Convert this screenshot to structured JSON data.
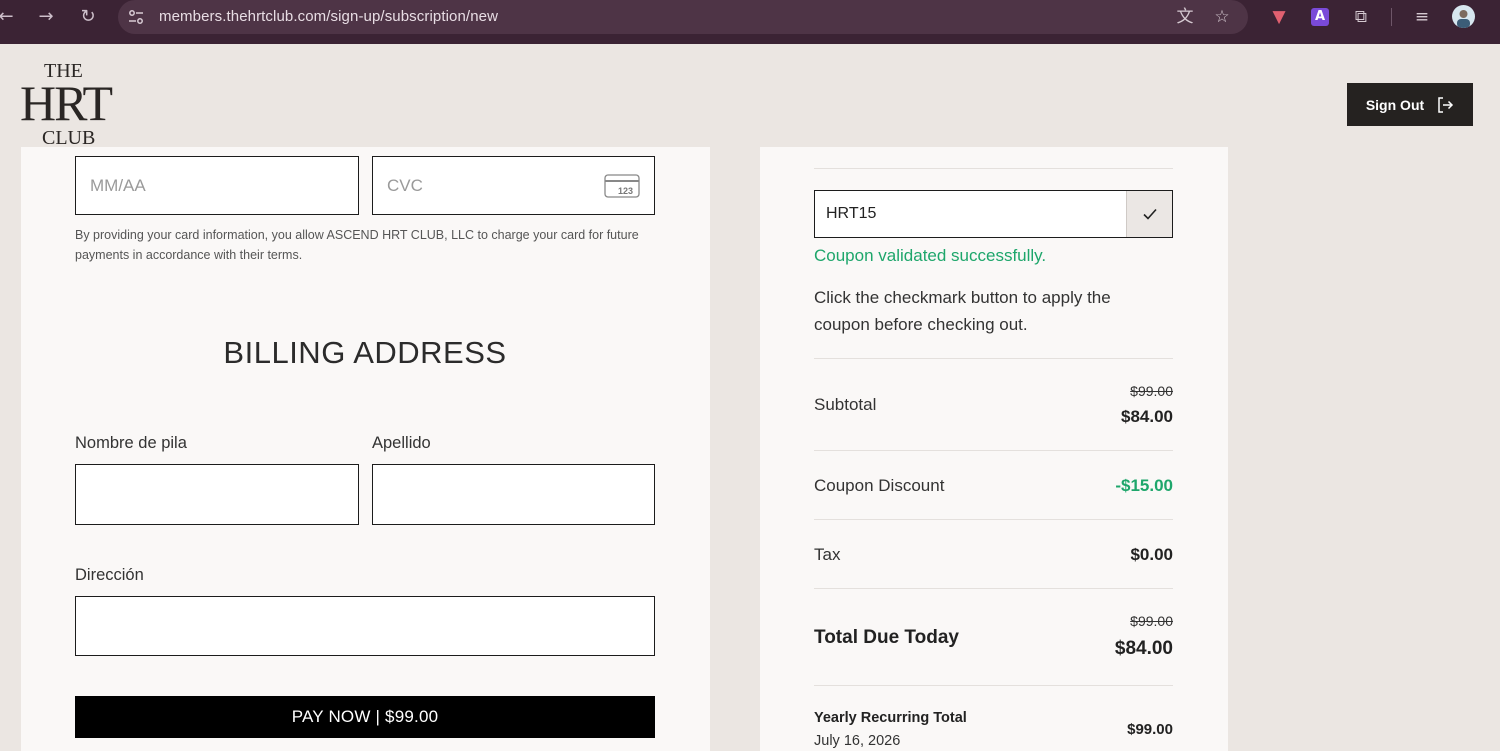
{
  "browser": {
    "url": "members.thehrtclub.com/sign-up/subscription/new",
    "ext_label": "A",
    "icons": [
      "back-arrow",
      "forward-arrow",
      "reload",
      "site-settings",
      "translate",
      "star",
      "extension-shield",
      "extension-a",
      "puzzle",
      "media-list",
      "profile-avatar"
    ]
  },
  "header": {
    "logo": {
      "line1": "THE",
      "line2": "HRT",
      "line3": "CLUB"
    },
    "sign_out": "Sign Out"
  },
  "payment": {
    "expiry_placeholder": "MM/AA",
    "cvc_placeholder": "CVC",
    "cvc_icon_text": "123",
    "authorization_text": "By providing your card information, you allow ASCEND HRT CLUB, LLC to charge your card for future payments in accordance with their terms."
  },
  "billing": {
    "title": "BILLING ADDRESS",
    "first_name_label": "Nombre de pila",
    "last_name_label": "Apellido",
    "address_label": "Dirección",
    "first_name_value": "",
    "last_name_value": "",
    "address_value": "",
    "pay_button": "PAY NOW | $99.00"
  },
  "summary": {
    "coupon_value": "HRT15",
    "coupon_success": "Coupon validated successfully.",
    "coupon_hint": "Click the checkmark button to apply the coupon before checking out.",
    "subtotal_label": "Subtotal",
    "subtotal_original": "$99.00",
    "subtotal_amount": "$84.00",
    "discount_label": "Coupon Discount",
    "discount_amount": "-$15.00",
    "tax_label": "Tax",
    "tax_amount": "$0.00",
    "total_label": "Total Due Today",
    "total_original": "$99.00",
    "total_amount": "$84.00",
    "recurring_label": "Yearly Recurring Total",
    "recurring_date": "July 16, 2026",
    "recurring_amount": "$99.00"
  },
  "colors": {
    "page_bg": "#ebe6e2",
    "card_bg": "#faf8f7",
    "chrome_bg": "#3b2334",
    "success_green": "#1ea66b",
    "button_black": "#000000"
  }
}
